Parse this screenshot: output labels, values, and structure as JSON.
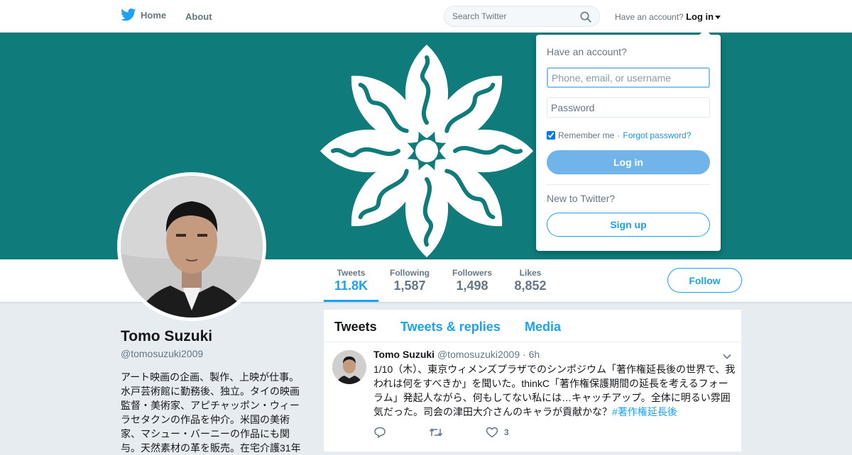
{
  "nav": {
    "home_label": "Home",
    "about_label": "About",
    "search_placeholder": "Search Twitter",
    "have_account": "Have an account?",
    "login_label": "Log in"
  },
  "profile": {
    "name": "Tomo Suzuki",
    "handle": "@tomosuzuki2009",
    "bio": "アート映画の企画、製作、上映が仕事。水戸芸術館に勤務後、独立。タイの映画監督・美術家、アピチャッポン・ウィーラセタクンの作品を仲介。米国の美術家、マシュー・バーニーの作品にも関与。天然素材の革を販売。在宅介護31年"
  },
  "stats": [
    {
      "label": "Tweets",
      "value": "11.8K"
    },
    {
      "label": "Following",
      "value": "1,587"
    },
    {
      "label": "Followers",
      "value": "1,498"
    },
    {
      "label": "Likes",
      "value": "8,852"
    }
  ],
  "follow_label": "Follow",
  "timeline": {
    "tabs": [
      "Tweets",
      "Tweets & replies",
      "Media"
    ],
    "tweet": {
      "name": "Tomo Suzuki",
      "handle": "@tomosuzuki2009",
      "sep": "·",
      "time": "6h",
      "text": "1/10（木）、東京ウィメンズプラザでのシンポジウム「著作権延長後の世界で、我われは何をすべきか」を聞いた。thinkC「著作権保護期間の延長を考えるフォーラム」発起人ながら、何もしてない私には…キャッチアップ。全体に明るい雰囲気だった。司会の津田大介さんのキャラが貢献かな？",
      "hashtag": "#著作権延長後",
      "like_count": "3"
    }
  },
  "login_dropdown": {
    "title": "Have an account?",
    "username_placeholder": "Phone, email, or username",
    "password_placeholder": "Password",
    "remember_label": "Remember me",
    "dot": "·",
    "forgot_label": "Forgot password?",
    "login_button": "Log in",
    "new_label": "New to Twitter?",
    "signup_button": "Sign up"
  },
  "colors": {
    "accent": "#1da1f2",
    "banner": "#0f7b7b"
  }
}
